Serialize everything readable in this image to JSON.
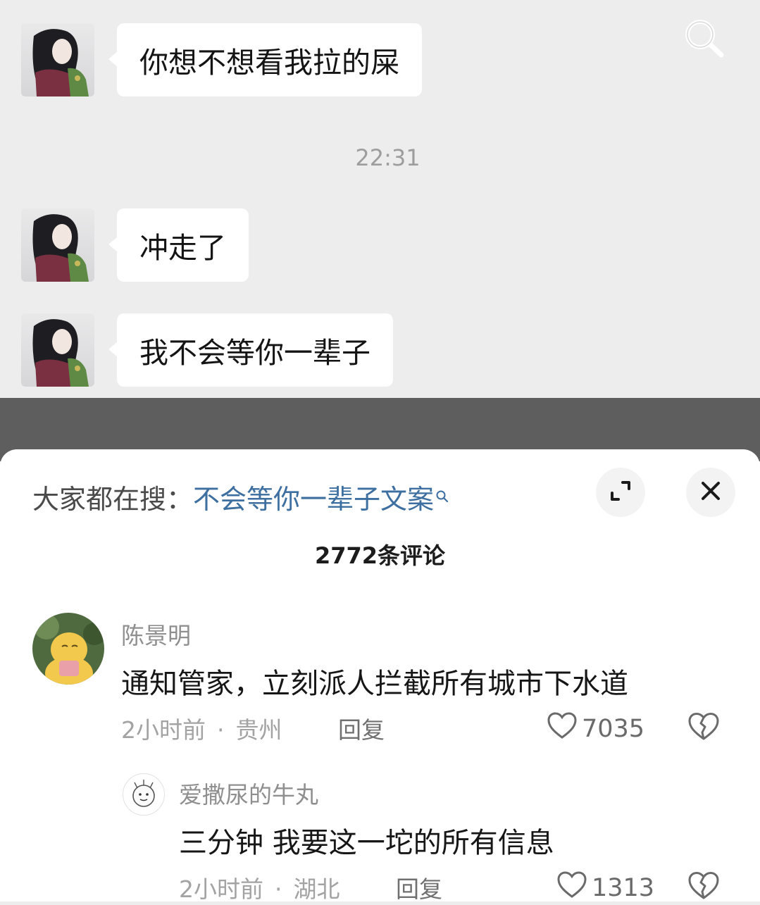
{
  "chat": {
    "messages": [
      {
        "text": "你想不想看我拉的屎"
      },
      {
        "text": "冲走了"
      },
      {
        "text": "我不会等你一辈子"
      }
    ],
    "timestamp": "22:31"
  },
  "sheet": {
    "suggest_label": "大家都在搜：",
    "suggest_query": "不会等你一辈子文案",
    "comment_count": "2772条评论",
    "comments": [
      {
        "author": "陈景明",
        "text": "通知管家，立刻派人拦截所有城市下水道",
        "time": "2小时前",
        "location": "贵州",
        "reply_label": "回复",
        "likes": "7035"
      },
      {
        "author": "爱撒尿的牛丸",
        "text": "三分钟 我要这一坨的所有信息",
        "time": "2小时前",
        "location": "湖北",
        "reply_label": "回复",
        "likes": "1313"
      }
    ]
  },
  "icons": {
    "top_search": "search-icon",
    "suggest_search": "search-icon",
    "expand": "expand-icon",
    "close": "close-icon",
    "like": "heart-icon",
    "dislike": "broken-heart-icon"
  },
  "colors": {
    "chat_background": "#ededed",
    "bubble": "#ffffff",
    "query_link": "#3d6fa0",
    "overlay": "#5e5e5e"
  }
}
